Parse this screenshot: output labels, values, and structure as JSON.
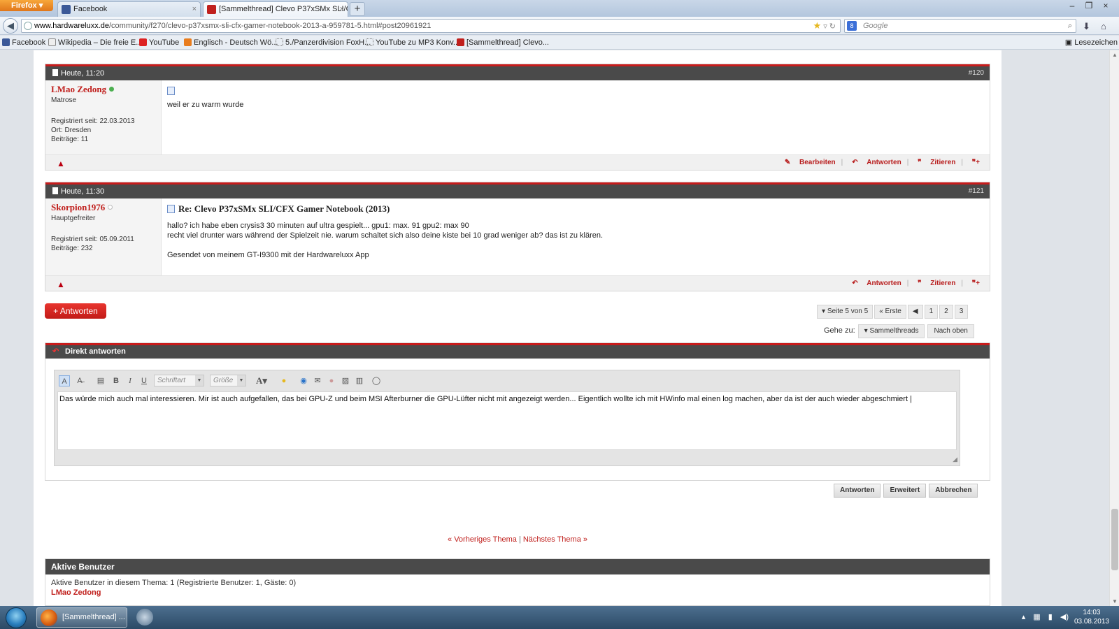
{
  "browser": {
    "menu_label": "Firefox",
    "tabs": [
      {
        "label": "Facebook",
        "close": "×"
      },
      {
        "label": "[Sammelthread] Clevo P37xSMx SLI/C...",
        "close": "×"
      }
    ],
    "new_tab": "+",
    "window_controls": [
      "–",
      "❐",
      "×"
    ],
    "url_host": "www.hardwareluxx.de",
    "url_path": "/community/f270/clevo-p37xsmx-sli-cfx-gamer-notebook-2013-a-959781-5.html#post20961921",
    "search_placeholder": "Google",
    "bookmarks": [
      "Facebook",
      "Wikipedia – Die freie E...",
      "YouTube",
      "Englisch - Deutsch Wö...",
      "5./Panzerdivision FoxH...",
      "YouTube zu MP3 Konv...",
      "[Sammelthread] Clevo..."
    ],
    "bookmarks_menu": "Lesezeichen"
  },
  "posts": [
    {
      "date": "Heute, 11:20",
      "number": "#120",
      "username": "LMao Zedong",
      "online": true,
      "user_title": "Matrose",
      "stats": [
        "Registriert seit: 22.03.2013",
        "Ort: Dresden",
        "Beiträge: 11"
      ],
      "title": "",
      "lines": [
        "weil er zu warm wurde"
      ],
      "actions": [
        "Bearbeiten",
        "Antworten",
        "Zitieren"
      ]
    },
    {
      "date": "Heute, 11:30",
      "number": "#121",
      "username": "Skorpion1976",
      "online": false,
      "user_title": "Hauptgefreiter",
      "stats": [
        "Registriert seit: 05.09.2011",
        "Beiträge: 232"
      ],
      "title": "Re: Clevo P37xSMx SLI/CFX Gamer Notebook (2013)",
      "lines": [
        "hallo? ich habe eben crysis3 30 minuten auf ultra gespielt... gpu1: max. 91 gpu2: max 90",
        "recht viel drunter wars während der Spielzeit nie. warum schaltet sich also deine kiste bei 10 grad weniger ab? das ist zu klären.",
        "",
        "Gesendet von meinem GT-I9300 mit der Hardwareluxx App"
      ],
      "actions": [
        "Antworten",
        "Zitieren"
      ]
    }
  ],
  "thread_controls": {
    "reply_button": "+ Antworten",
    "pager_label": "Seite 5 von 5",
    "pager_first": "« Erste",
    "pager_pages": [
      "1",
      "2",
      "3"
    ],
    "goto_label": "Gehe zu:",
    "goto_select": "Sammelthreads",
    "goto_top": "Nach oben"
  },
  "quick_reply": {
    "title": "Direkt antworten",
    "font_select": "Schriftart",
    "size_select": "Größe",
    "text": "Das würde mich auch mal interessieren. Mir ist auch aufgefallen, das bei GPU-Z und beim MSI Afterburner die GPU-Lüfter nicht mit angezeigt werden... Eigentlich wollte ich mit HWinfo mal einen log machen, aber da ist der auch wieder abgeschmiert |",
    "buttons": [
      "Antworten",
      "Erweitert",
      "Abbrechen"
    ]
  },
  "thread_nav": {
    "prev": "« Vorheriges Thema",
    "next": "Nächstes Thema »"
  },
  "active_users": {
    "title": "Aktive Benutzer",
    "summary": "Aktive Benutzer in diesem Thema: 1 (Registrierte Benutzer: 1, Gäste: 0)",
    "user": "LMao Zedong"
  },
  "taskbar": {
    "app_label": "[Sammelthread] ...",
    "time": "14:03",
    "date": "03.08.2013"
  },
  "colors": {
    "accent_red": "#c0201d",
    "header_dark": "#4a4a4a",
    "online": "#4caf50",
    "offline": "#bbbbbb"
  }
}
